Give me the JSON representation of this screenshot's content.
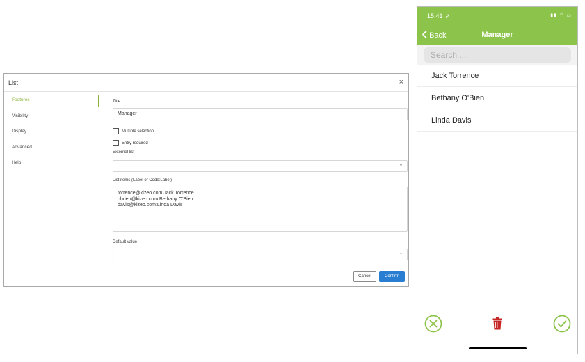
{
  "dialog": {
    "title": "List",
    "close_symbol": "×",
    "nav": [
      {
        "label": "Features"
      },
      {
        "label": "Visibility"
      },
      {
        "label": "Display"
      },
      {
        "label": "Advanced"
      },
      {
        "label": "Help"
      }
    ],
    "form": {
      "title_label": "Title",
      "title_value": "Manager",
      "multiple_selection_label": "Multiple selection",
      "entry_required_label": "Entry required",
      "external_list_label": "External list",
      "external_list_value": "",
      "list_items_label": "List items (Label or Code:Label)",
      "list_items": [
        "torrence@kizeo.com:Jack Torrence",
        "obrien@kizeo.com:Bethany O'Bien",
        "davis@kizeo.com:Linda Davis"
      ],
      "default_value_label": "Default value",
      "default_value": ""
    },
    "buttons": {
      "cancel": "Cancel",
      "confirm": "Confirm"
    }
  },
  "phone": {
    "status": {
      "time": "15:41 ⇗",
      "icons": "▮▮ ⌔ ▭"
    },
    "nav": {
      "back_label": "Back",
      "title": "Manager"
    },
    "search": {
      "placeholder": "Search ..."
    },
    "items": [
      {
        "label": "Jack Torrence"
      },
      {
        "label": "Bethany O'Bien"
      },
      {
        "label": "Linda Davis"
      }
    ],
    "colors": {
      "accent": "#8cc34a",
      "delete": "#c62828"
    }
  }
}
